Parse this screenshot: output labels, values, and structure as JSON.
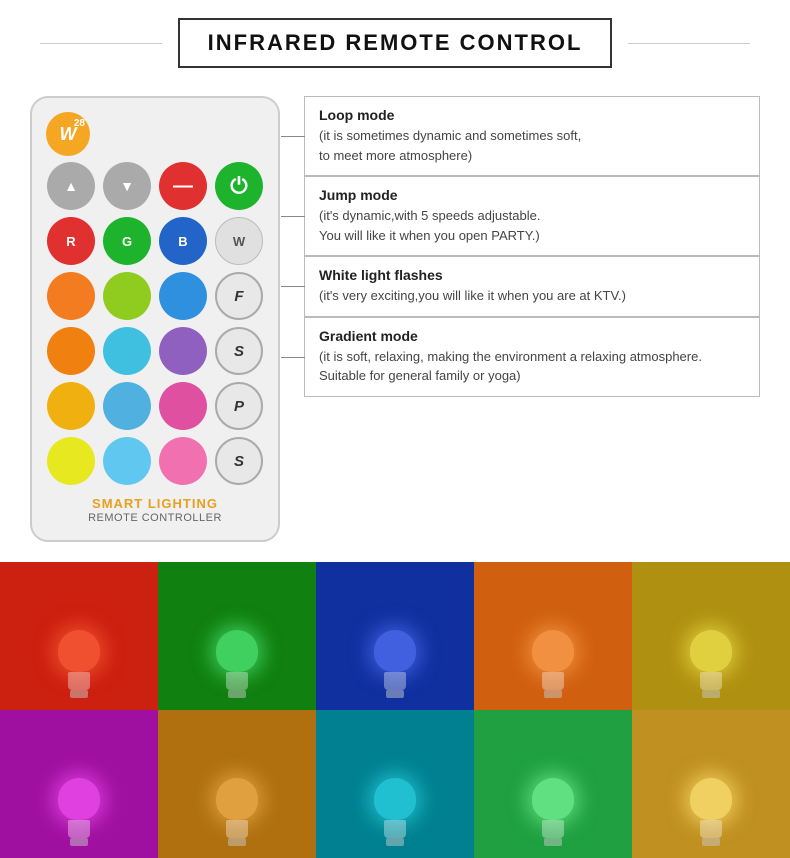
{
  "header": {
    "title": "INFRARED REMOTE CONTROL"
  },
  "remote": {
    "badge_letter": "W",
    "badge_num": "28",
    "label_top": "SMART LIGHTING",
    "label_bottom": "REMOTE CONTROLLER",
    "rows": {
      "row1": [
        "brightness_up",
        "brightness_down",
        "minus",
        "power"
      ],
      "row2": [
        "R",
        "G",
        "B",
        "W"
      ],
      "colors_row1": [
        "#f47c20",
        "#90cc20",
        "#3090e0",
        "null"
      ],
      "colors_row2": [
        "#f08010",
        "#40c0e0",
        "#9060c0",
        "null"
      ],
      "colors_row3": [
        "#f0b010",
        "#50b0e0",
        "#e050a0",
        "null"
      ],
      "colors_row4": [
        "#e8e820",
        "#60c8f0",
        "#f070b0",
        "null"
      ]
    }
  },
  "info_boxes": [
    {
      "title": "Loop mode",
      "desc": "(it is sometimes dynamic and sometimes soft,\nto meet more atmosphere)"
    },
    {
      "title": "Jump mode",
      "desc": "(it's dynamic,with 5 speeds adjustable.\nYou will like it when you open PARTY.)"
    },
    {
      "title": "White light flashes",
      "desc": "(it's very exciting,you will like it when you are at KTV.)"
    },
    {
      "title": "Gradient mode",
      "desc": "(it is soft, relaxing, making the environment a relaxing atmosphere.\nSuitable for general family or yoga)"
    }
  ],
  "color_cells": [
    {
      "bg": "#cc2010",
      "globe": "#f05030"
    },
    {
      "bg": "#108010",
      "globe": "#40d060"
    },
    {
      "bg": "#1030a0",
      "globe": "#4060e0"
    },
    {
      "bg": "#d06010",
      "globe": "#f09040"
    },
    {
      "bg": "#b09010",
      "globe": "#e0d040"
    },
    {
      "bg": "#a010a0",
      "globe": "#e040e0"
    },
    {
      "bg": "#b07010",
      "globe": "#e0a040"
    },
    {
      "bg": "#008090",
      "globe": "#20c0d0"
    },
    {
      "bg": "#20a040",
      "globe": "#60e080"
    },
    {
      "bg": "#c09020",
      "globe": "#f0d060"
    }
  ]
}
